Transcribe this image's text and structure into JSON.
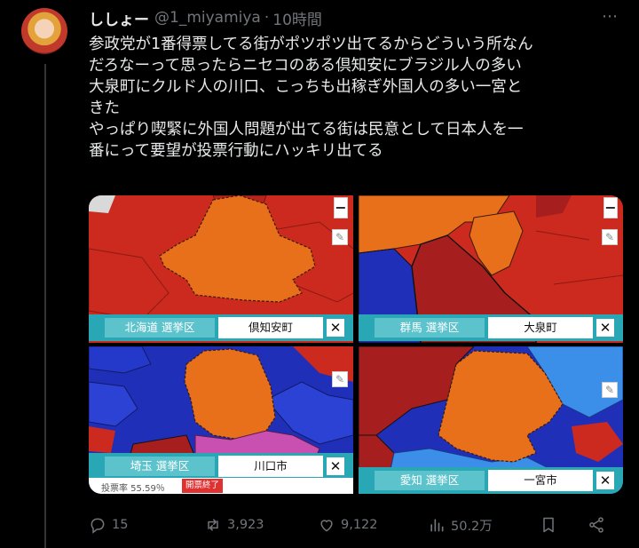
{
  "tweet": {
    "display_name": "ししょー",
    "handle": "@1_miyamiya",
    "separator": "·",
    "time": "10時間",
    "more_icon": "⋯",
    "text_lines": [
      "参政党が1番得票してる街がポツポツ出てるからどういう所なん",
      "だろなーって思ったらニセコのある倶知安にブラジル人の多い",
      "大泉町にクルド人の川口、こっちも出稼ぎ外国人の多い一宮と",
      "きた",
      "やっぱり喫緊に外国人問題が出てる街は民意として日本人を一",
      "番にって要望が投票行動にハッキリ出てる"
    ]
  },
  "maps": [
    {
      "region": "北海道 選挙区",
      "city": "倶知安町",
      "close": "✕"
    },
    {
      "region": "群馬 選挙区",
      "city": "大泉町",
      "close": "✕"
    },
    {
      "region": "埼玉 選挙区",
      "city": "川口市",
      "close": "✕",
      "vote_text": "投票率 55.59％",
      "vote_badge": "開票終了"
    },
    {
      "region": "愛知 選挙区",
      "city": "一宮市",
      "close": "✕"
    }
  ],
  "map_controls": {
    "zoom_in": "+",
    "zoom_out": "−",
    "edit": "✎"
  },
  "colors": {
    "background": "#000000",
    "text": "#e7e9ea",
    "muted": "#71767b",
    "sanseito_orange": "#e8701a",
    "ldp_red": "#cc2a1f",
    "dark_red": "#a61e1e",
    "blue": "#1f2fb8",
    "light_blue": "#3b8fe8",
    "magenta": "#c94fb0",
    "region_bar": "#2aa7b5"
  },
  "actions": {
    "reply_count": "15",
    "retweet_count": "3,923",
    "like_count": "9,122",
    "views_count": "50.2万"
  }
}
